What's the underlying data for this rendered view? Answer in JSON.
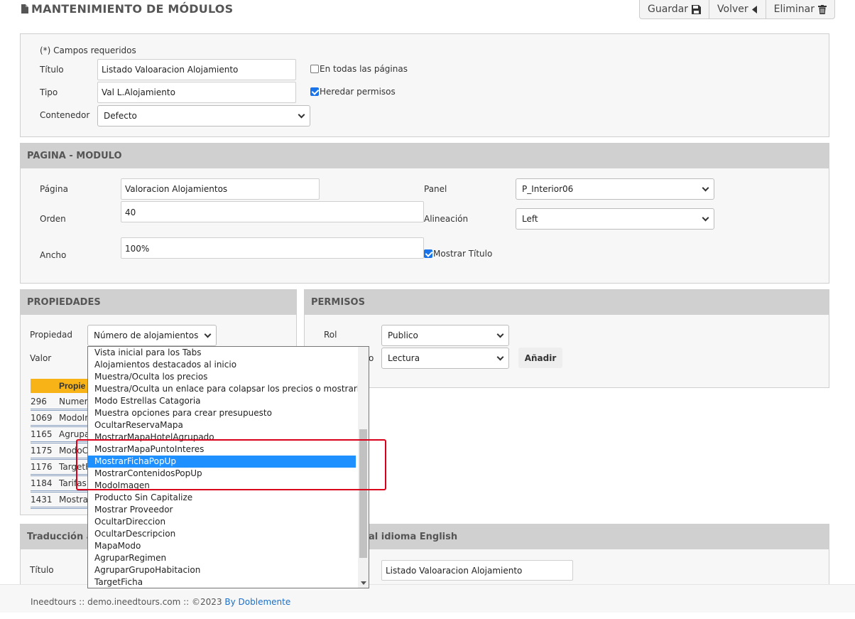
{
  "header": {
    "title": "MANTENIMIENTO DE MÓDULOS",
    "buttons": {
      "save": "Guardar",
      "back": "Volver",
      "delete": "Eliminar"
    }
  },
  "module_form": {
    "required_note": "(*) Campos requeridos",
    "titulo_label": "Título",
    "titulo_value": "Listado Valoaracion Alojamiento",
    "tipo_label": "Tipo",
    "tipo_value": "Val L.Alojamiento",
    "contenedor_label": "Contenedor",
    "contenedor_value": "Defecto",
    "all_pages_label": "En todas las páginas",
    "all_pages_checked": false,
    "inherit_label": "Heredar permisos",
    "inherit_checked": true
  },
  "pagina_modulo": {
    "heading": "PAGINA - MODULO",
    "pagina_label": "Página",
    "pagina_value": "Valoracion Alojamientos",
    "orden_label": "Orden",
    "orden_value": "40",
    "ancho_label": "Ancho",
    "ancho_value": "100%",
    "panel_label": "Panel",
    "panel_value": "P_Interior06",
    "alineacion_label": "Alineación",
    "alineacion_value": "Left",
    "mostrar_titulo_label": "Mostrar Título",
    "mostrar_titulo_checked": true
  },
  "propiedades": {
    "heading": "PROPIEDADES",
    "propiedad_label": "Propiedad",
    "propiedad_value": "Número de alojamientos x",
    "valor_label": "Valor",
    "table_header": "Propie",
    "rows": [
      {
        "id": "296",
        "name": "Numero"
      },
      {
        "id": "1069",
        "name": "ModoIn"
      },
      {
        "id": "1165",
        "name": "Agrupa"
      },
      {
        "id": "1175",
        "name": "ModoC"
      },
      {
        "id": "1176",
        "name": "TargetF"
      },
      {
        "id": "1184",
        "name": "Tarifas"
      },
      {
        "id": "1431",
        "name": "Mostra"
      }
    ]
  },
  "permisos": {
    "heading": "PERMISOS",
    "rol_label": "Rol",
    "rol_value": "Publico",
    "tipo_label_fragment": "o",
    "tipo_value": "Lectura",
    "add_button": "Añadir"
  },
  "dropdown": {
    "options": [
      "Vista inicial para los Tabs",
      "Alojamientos destacados al inicio",
      "Muestra/Oculta los precios",
      "Muestra/Oculta un enlace para colapsar los precios o mostrarlos",
      "Modo Estrellas Catagoria",
      "Muestra opciones para crear presupuesto",
      "OcultarReservaMapa",
      "MostrarMapaHotelAgrupado",
      "MostrarMapaPuntoInteres",
      "MostrarFichaPopUp",
      "MostrarContenidosPopUp",
      "ModoImagen",
      "Producto Sin Capitalize",
      "Mostrar Proveedor",
      "OcultarDireccion",
      "OcultarDescripcion",
      "MapaModo",
      "AgruparRegimen",
      "AgruparGrupoHabitacion",
      "TargetFicha"
    ],
    "selected": "MostrarFichaPopUp"
  },
  "traduccion": {
    "heading_left": "Traducción a",
    "heading_right": "al idioma English",
    "titulo_label": "Título",
    "titulo_value": "Listado Valoaracion Alojamiento"
  },
  "footer": {
    "text": "Ineedtours :: demo.ineedtours.com :: ©2023 ",
    "link": "By Doblemente"
  },
  "colors": {
    "table_header": "#f8b416",
    "selection": "#1e90ff",
    "highlight": "#d9001b",
    "link": "#1a6fc9"
  }
}
